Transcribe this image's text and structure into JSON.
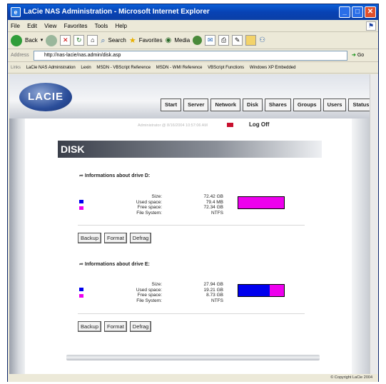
{
  "window": {
    "title": "LaCie NAS Administration - Microsoft Internet Explorer"
  },
  "menubar": {
    "items": [
      "File",
      "Edit",
      "View",
      "Favorites",
      "Tools",
      "Help"
    ]
  },
  "toolbar": {
    "back": "Back",
    "search": "Search",
    "favorites": "Favorites",
    "media": "Media"
  },
  "addressbar": {
    "label": "Address",
    "url": "http://nas-lacie/nas.admin/disk.asp",
    "go": "Go"
  },
  "linksbar": {
    "label": "Links",
    "items": [
      "LaCie NAS Administration",
      "Lexin",
      "MSDN - VBScript Reference",
      "MSDN - WMI Reference",
      "VBScript Functions",
      "Windows XP Embedded"
    ]
  },
  "page": {
    "logo": "LACIE",
    "nav": [
      "Start",
      "Server",
      "Network",
      "Disk",
      "Shares",
      "Groups",
      "Users",
      "Status"
    ],
    "admin_line": "Administrator @ 8/16/2004 10:57:06 AM",
    "logoff": "Log Off",
    "section_title": "DISK",
    "labels": {
      "size": "Size:",
      "used": "Used space:",
      "free": "Free space:",
      "fs": "File System:"
    },
    "buttons": {
      "backup": "Backup",
      "format": "Format",
      "defrag": "Defrag"
    },
    "drives": [
      {
        "heading": "Informations about drive D:",
        "size": "72.42 GB",
        "used": "79.4 MB",
        "free": "72.34 GB",
        "fs": "NTFS",
        "used_fraction": 0.001
      },
      {
        "heading": "Informations about drive E:",
        "size": "27.94 GB",
        "used": "19.21 GB",
        "free": "8.73 GB",
        "fs": "NTFS",
        "used_fraction": 0.6875
      }
    ],
    "copyright": "© Copyright LaCie 2004"
  },
  "colors": {
    "used": "#0000ee",
    "free": "#ee00ee"
  }
}
